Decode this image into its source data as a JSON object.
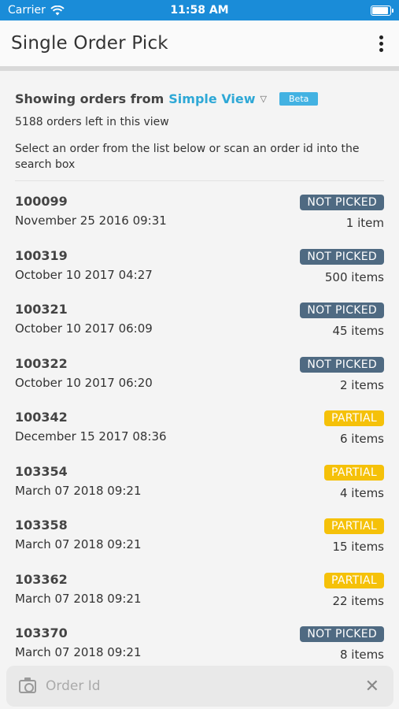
{
  "status_bar": {
    "carrier": "Carrier",
    "time": "11:58 AM"
  },
  "app_bar": {
    "title": "Single Order Pick"
  },
  "header": {
    "showing_prefix": "Showing orders from",
    "view_name": "Simple View",
    "beta_label": "Beta",
    "count_text": "5188 orders left in this view",
    "hint": "Select an order from the list below or scan an order id into the search box"
  },
  "orders": [
    {
      "id": "100099",
      "date": "November 25 2016 09:31",
      "status": "NOT PICKED",
      "status_type": "not-picked",
      "items": "1 item"
    },
    {
      "id": "100319",
      "date": "October 10 2017 04:27",
      "status": "NOT PICKED",
      "status_type": "not-picked",
      "items": "500 items"
    },
    {
      "id": "100321",
      "date": "October 10 2017 06:09",
      "status": "NOT PICKED",
      "status_type": "not-picked",
      "items": "45 items"
    },
    {
      "id": "100322",
      "date": "October 10 2017 06:20",
      "status": "NOT PICKED",
      "status_type": "not-picked",
      "items": "2 items"
    },
    {
      "id": "100342",
      "date": "December 15 2017 08:36",
      "status": "PARTIAL",
      "status_type": "partial",
      "items": "6 items"
    },
    {
      "id": "103354",
      "date": "March 07 2018 09:21",
      "status": "PARTIAL",
      "status_type": "partial",
      "items": "4 items"
    },
    {
      "id": "103358",
      "date": "March 07 2018 09:21",
      "status": "PARTIAL",
      "status_type": "partial",
      "items": "15 items"
    },
    {
      "id": "103362",
      "date": "March 07 2018 09:21",
      "status": "PARTIAL",
      "status_type": "partial",
      "items": "22 items"
    },
    {
      "id": "103370",
      "date": "March 07 2018 09:21",
      "status": "NOT PICKED",
      "status_type": "not-picked",
      "items": "8 items"
    }
  ],
  "search": {
    "placeholder": "Order Id",
    "value": ""
  },
  "colors": {
    "status_bar": "#1a8cd8",
    "accent": "#2ea8d6",
    "not_picked": "#4f6a82",
    "partial": "#f5c109"
  }
}
